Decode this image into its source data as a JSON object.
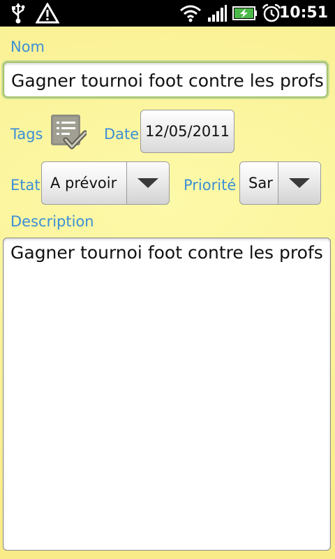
{
  "status_bar": {
    "time": "10:51",
    "icons": [
      "usb-icon",
      "warning-icon",
      "wifi-icon",
      "signal-icon",
      "battery-charging-icon",
      "alarm-icon"
    ]
  },
  "form": {
    "name_label": "Nom",
    "name_value": "Gagner tournoi foot contre les profs",
    "tags_label": "Tags",
    "date_label": "Date",
    "date_value": "12/05/2011",
    "state_label": "Etat",
    "state_value": "A prévoir",
    "priority_label": "Priorité",
    "priority_value": "Sar",
    "description_label": "Description",
    "description_value": "Gagner tournoi foot contre les profs"
  },
  "colors": {
    "background": "#fbf39a",
    "label": "#3d8fd6",
    "focus_border": "#a6c36b"
  }
}
